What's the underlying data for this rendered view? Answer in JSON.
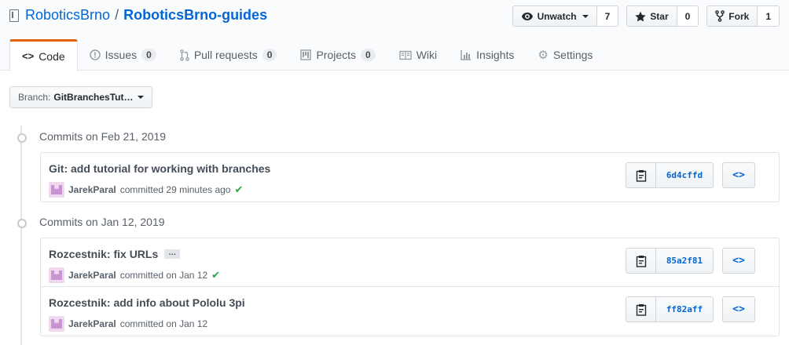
{
  "repo": {
    "owner": "RoboticsBrno",
    "separator": "/",
    "name": "RoboticsBrno-guides"
  },
  "actions": {
    "watch": {
      "label": "Unwatch",
      "count": "7"
    },
    "star": {
      "label": "Star",
      "count": "0"
    },
    "fork": {
      "label": "Fork",
      "count": "1"
    }
  },
  "tabs": [
    {
      "label": "Code",
      "icon": "code-icon"
    },
    {
      "label": "Issues",
      "icon": "issue-icon",
      "count": "0"
    },
    {
      "label": "Pull requests",
      "icon": "pull-request-icon",
      "count": "0"
    },
    {
      "label": "Projects",
      "icon": "project-icon",
      "count": "0"
    },
    {
      "label": "Wiki",
      "icon": "book-icon"
    },
    {
      "label": "Insights",
      "icon": "graph-icon"
    },
    {
      "label": "Settings",
      "icon": "gear-icon"
    }
  ],
  "branch": {
    "prefix": "Branch:",
    "value": "GitBranchesTut…"
  },
  "groups": [
    {
      "title": "Commits on Feb 21, 2019",
      "commits": [
        {
          "message": "Git: add tutorial for working with branches",
          "author": "JarekParal",
          "action": "committed 29 minutes ago",
          "status": "success",
          "sha": "6d4cffd"
        }
      ]
    },
    {
      "title": "Commits on Jan 12, 2019",
      "commits": [
        {
          "message": "Rozcestnik: fix URLs",
          "ellipsis": "…",
          "author": "JarekParal",
          "action": "committed on Jan 12",
          "status": "success",
          "sha": "85a2f81"
        },
        {
          "message": "Rozcestnik: add info about Pololu 3pi",
          "author": "JarekParal",
          "action": "committed on Jan 12",
          "sha": "ff82aff"
        }
      ]
    }
  ],
  "colors": {
    "link": "#0366d6",
    "tab_accent": "#e36209",
    "success": "#28a745"
  },
  "browse_symbol": "<>",
  "check_symbol": "✔"
}
